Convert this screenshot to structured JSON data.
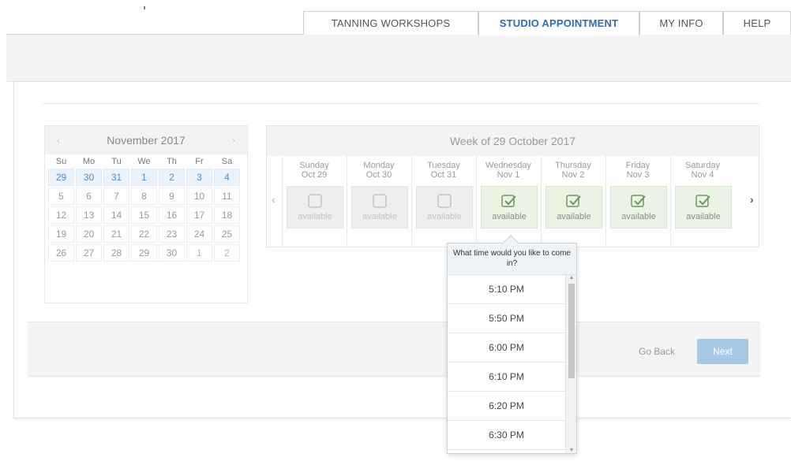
{
  "nav": {
    "tabs": [
      {
        "label": "TANNING WORKSHOPS"
      },
      {
        "label": "STUDIO APPOINTMENT"
      },
      {
        "label": "MY INFO"
      },
      {
        "label": "HELP"
      }
    ],
    "active_tab": "STUDIO APPOINTMENT"
  },
  "month_calendar": {
    "title": "November 2017",
    "prev_icon": "chevron-left-icon",
    "next_icon": "chevron-right-icon",
    "weekdays": [
      "Su",
      "Mo",
      "Tu",
      "We",
      "Th",
      "Fr",
      "Sa"
    ],
    "weeks": [
      [
        "29",
        "30",
        "31",
        "1",
        "2",
        "3",
        "4"
      ],
      [
        "5",
        "6",
        "7",
        "8",
        "9",
        "10",
        "11"
      ],
      [
        "12",
        "13",
        "14",
        "15",
        "16",
        "17",
        "18"
      ],
      [
        "19",
        "20",
        "21",
        "22",
        "23",
        "24",
        "25"
      ],
      [
        "26",
        "27",
        "28",
        "29",
        "30",
        "1",
        "2"
      ]
    ]
  },
  "week_view": {
    "title": "Week of 29 October 2017",
    "days": [
      {
        "name": "Sunday",
        "date": "Oct 29",
        "status": "available",
        "enabled": false
      },
      {
        "name": "Monday",
        "date": "Oct 30",
        "status": "available",
        "enabled": false
      },
      {
        "name": "Tuesday",
        "date": "Oct 31",
        "status": "available",
        "enabled": false
      },
      {
        "name": "Wednesday",
        "date": "Nov 1",
        "status": "available",
        "enabled": true
      },
      {
        "name": "Thursday",
        "date": "Nov 2",
        "status": "available",
        "enabled": true
      },
      {
        "name": "Friday",
        "date": "Nov 3",
        "status": "available",
        "enabled": true
      },
      {
        "name": "Saturday",
        "date": "Nov 4",
        "status": "available",
        "enabled": true
      }
    ],
    "prev_icon": "chevron-left-icon",
    "next_icon": "chevron-right-icon"
  },
  "time_popup": {
    "question": "What time would you like to come in?",
    "slots": [
      "5:10 PM",
      "5:50 PM",
      "6:00 PM",
      "6:10 PM",
      "6:20 PM",
      "6:30 PM"
    ]
  },
  "footer": {
    "back_label": "Go Back",
    "next_label": "Next"
  },
  "colors": {
    "accent": "#2a6db5",
    "available_bg": "#eaf3e4",
    "check_green": "#6a9a5e",
    "next_button": "#a6c9e8"
  }
}
